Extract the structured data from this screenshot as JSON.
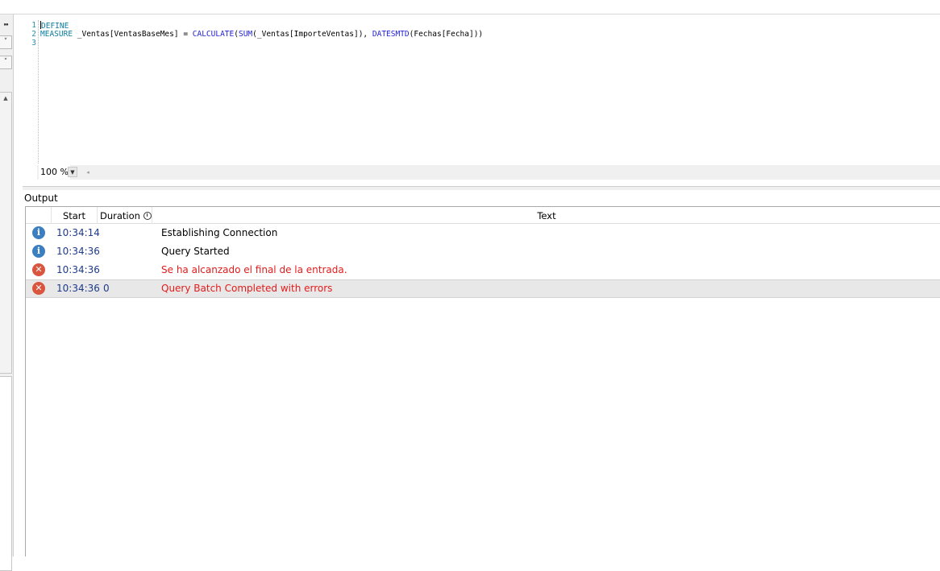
{
  "left_panel": {
    "pin_glyph": "❠",
    "dropdown_glyph": "˅",
    "scroll_up_glyph": "▲"
  },
  "editor": {
    "line_numbers": [
      "1",
      "2",
      "3"
    ],
    "code": {
      "line1_kw": "DEFINE",
      "line2_kw": "MEASURE",
      "line2_a": " _Ventas[VentasBaseMes] = ",
      "line2_fn1": "CALCULATE",
      "line2_b": "(",
      "line2_fn2": "SUM",
      "line2_c": "(_Ventas[ImporteVentas]), ",
      "line2_fn3": "DATESMTD",
      "line2_d": "(Fechas[Fecha]))"
    },
    "zoom_level": "100 %",
    "zoom_dropdown_glyph": "▼",
    "scroll_left_glyph": "◂",
    "colors": {
      "keyword": "#0b7c9e",
      "function": "#1f1fd6",
      "line_number": "#2b91af"
    }
  },
  "output": {
    "title": "Output",
    "columns": {
      "start": "Start",
      "duration": "Duration",
      "text": "Text"
    },
    "rows": [
      {
        "type": "info",
        "icon": "info-icon",
        "glyph": "i",
        "start": "10:34:14",
        "duration": "",
        "text": "Establishing Connection"
      },
      {
        "type": "info",
        "icon": "info-icon",
        "glyph": "i",
        "start": "10:34:36",
        "duration": "",
        "text": "Query Started"
      },
      {
        "type": "error",
        "icon": "error-icon",
        "glyph": "✕",
        "start": "10:34:36",
        "duration": "",
        "text": "Se ha alcanzado el final de la entrada."
      },
      {
        "type": "error",
        "icon": "error-icon",
        "glyph": "✕",
        "start": "10:34:36",
        "duration": "0",
        "text": "Query Batch Completed with errors",
        "selected": true
      }
    ],
    "colors": {
      "info": "#3c7fc1",
      "error": "#d9553d",
      "error_text": "#e31b1b",
      "time_text": "#1e3a8a"
    }
  }
}
